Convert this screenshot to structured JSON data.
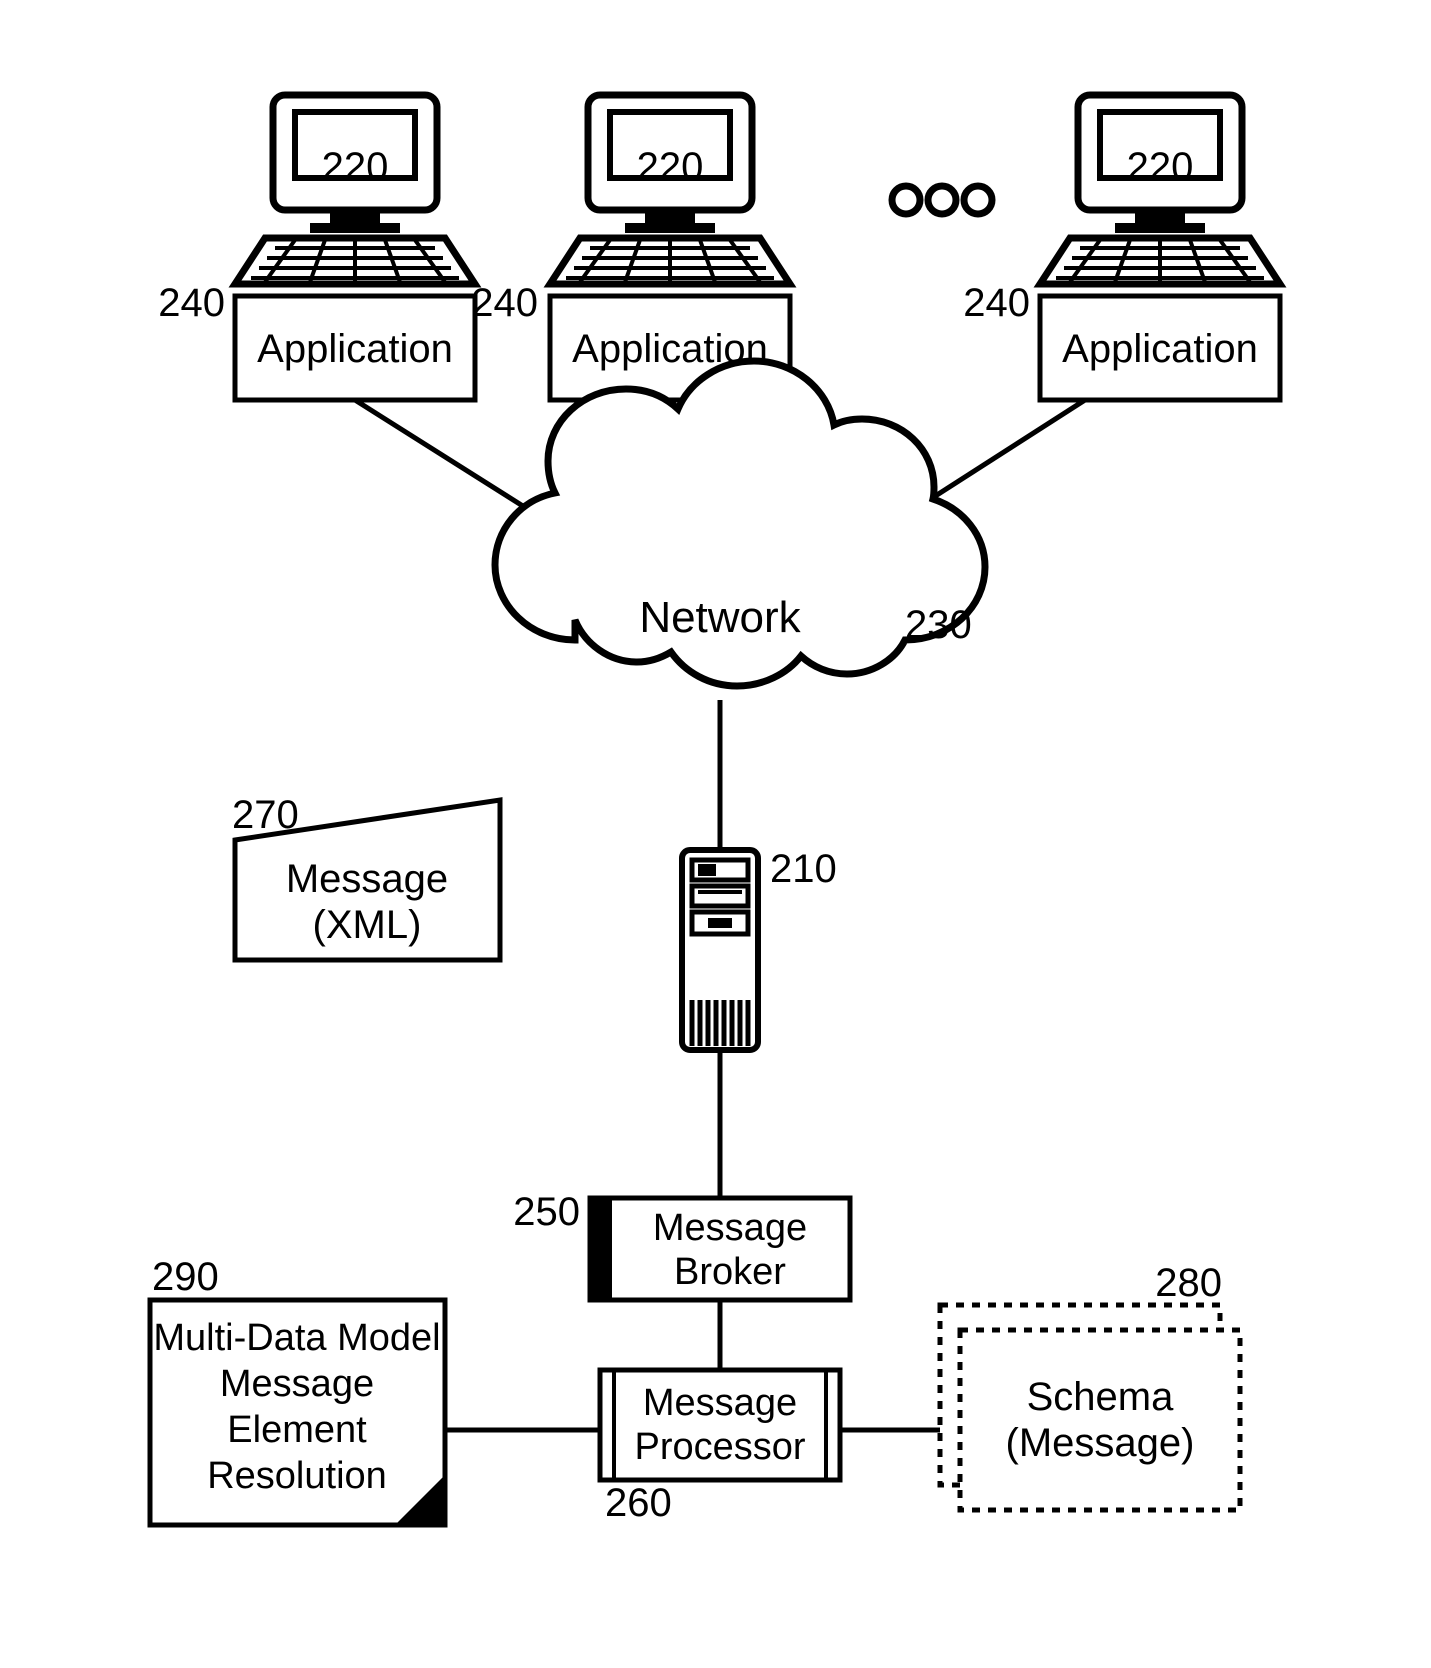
{
  "labels": {
    "client_screen": "220",
    "app_ref": "240",
    "app_box": "Application",
    "ellipsis": "OOO",
    "network": "Network",
    "network_ref": "230",
    "message_ref": "270",
    "message_line1": "Message",
    "message_line2": "(XML)",
    "server_ref": "210",
    "broker_ref": "250",
    "broker_line1": "Message",
    "broker_line2": "Broker",
    "processor_ref": "260",
    "processor_line1": "Message",
    "processor_line2": "Processor",
    "schema_ref": "280",
    "schema_line1": "Schema",
    "schema_line2": "(Message)",
    "resolver_ref": "290",
    "resolver_line1": "Multi-Data Model",
    "resolver_line2": "Message",
    "resolver_line3": "Element",
    "resolver_line4": "Resolution"
  }
}
